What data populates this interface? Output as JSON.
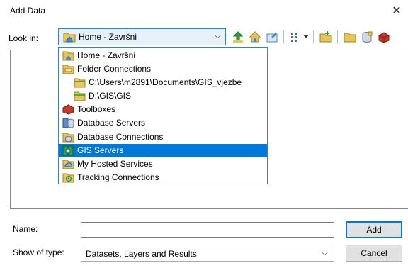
{
  "window": {
    "title": "Add Data",
    "close_glyph": "✕"
  },
  "look_in": {
    "label": "Look in:",
    "value": "Home - Završni",
    "icon": "home-folder-icon",
    "chevron": "⌵"
  },
  "toolbar": {
    "buttons": [
      {
        "name": "up-one-level-button",
        "icon": "arrow-up-icon"
      },
      {
        "name": "go-home-button",
        "icon": "home-icon"
      },
      {
        "name": "catalog-button",
        "icon": "catalog-icon"
      },
      {
        "name": "view-options-button",
        "icon": "list-view-icon"
      },
      {
        "name": "connect-folder-button",
        "icon": "connect-folder-icon"
      },
      {
        "name": "new-folder-button",
        "icon": "new-folder-icon"
      },
      {
        "name": "new-gdb-button",
        "icon": "database-icon"
      },
      {
        "name": "toolbox-button",
        "icon": "toolbox-icon"
      }
    ]
  },
  "dropdown": {
    "items": [
      {
        "label": "Home - Završni",
        "icon": "home-folder-icon",
        "indent": 0,
        "selected": false
      },
      {
        "label": "Folder Connections",
        "icon": "folder-connections-icon",
        "indent": 0,
        "selected": false
      },
      {
        "label": "C:\\Users\\m2891\\Documents\\GIS_vjezbe",
        "icon": "folder-icon",
        "indent": 1,
        "selected": false
      },
      {
        "label": "D:\\GIS\\GIS",
        "icon": "folder-icon",
        "indent": 1,
        "selected": false
      },
      {
        "label": "Toolboxes",
        "icon": "toolbox-icon",
        "indent": 0,
        "selected": false
      },
      {
        "label": "Database Servers",
        "icon": "database-server-icon",
        "indent": 0,
        "selected": false
      },
      {
        "label": "Database Connections",
        "icon": "database-connection-icon",
        "indent": 0,
        "selected": false
      },
      {
        "label": "GIS Servers",
        "icon": "gis-server-icon",
        "indent": 0,
        "selected": true
      },
      {
        "label": "My Hosted Services",
        "icon": "hosted-services-icon",
        "indent": 0,
        "selected": false
      },
      {
        "label": "Tracking Connections",
        "icon": "tracking-connection-icon",
        "indent": 0,
        "selected": false
      }
    ]
  },
  "name_field": {
    "label": "Name:",
    "value": ""
  },
  "type_field": {
    "label": "Show of type:",
    "value": "Datasets, Layers and Results",
    "chevron": "⌵"
  },
  "buttons": {
    "add": "Add",
    "cancel": "Cancel"
  },
  "colors": {
    "selection": "#0078d7",
    "combo_bg": "#e5f1fb",
    "combo_border": "#3c7fb1",
    "folder": "#e8c45c"
  }
}
